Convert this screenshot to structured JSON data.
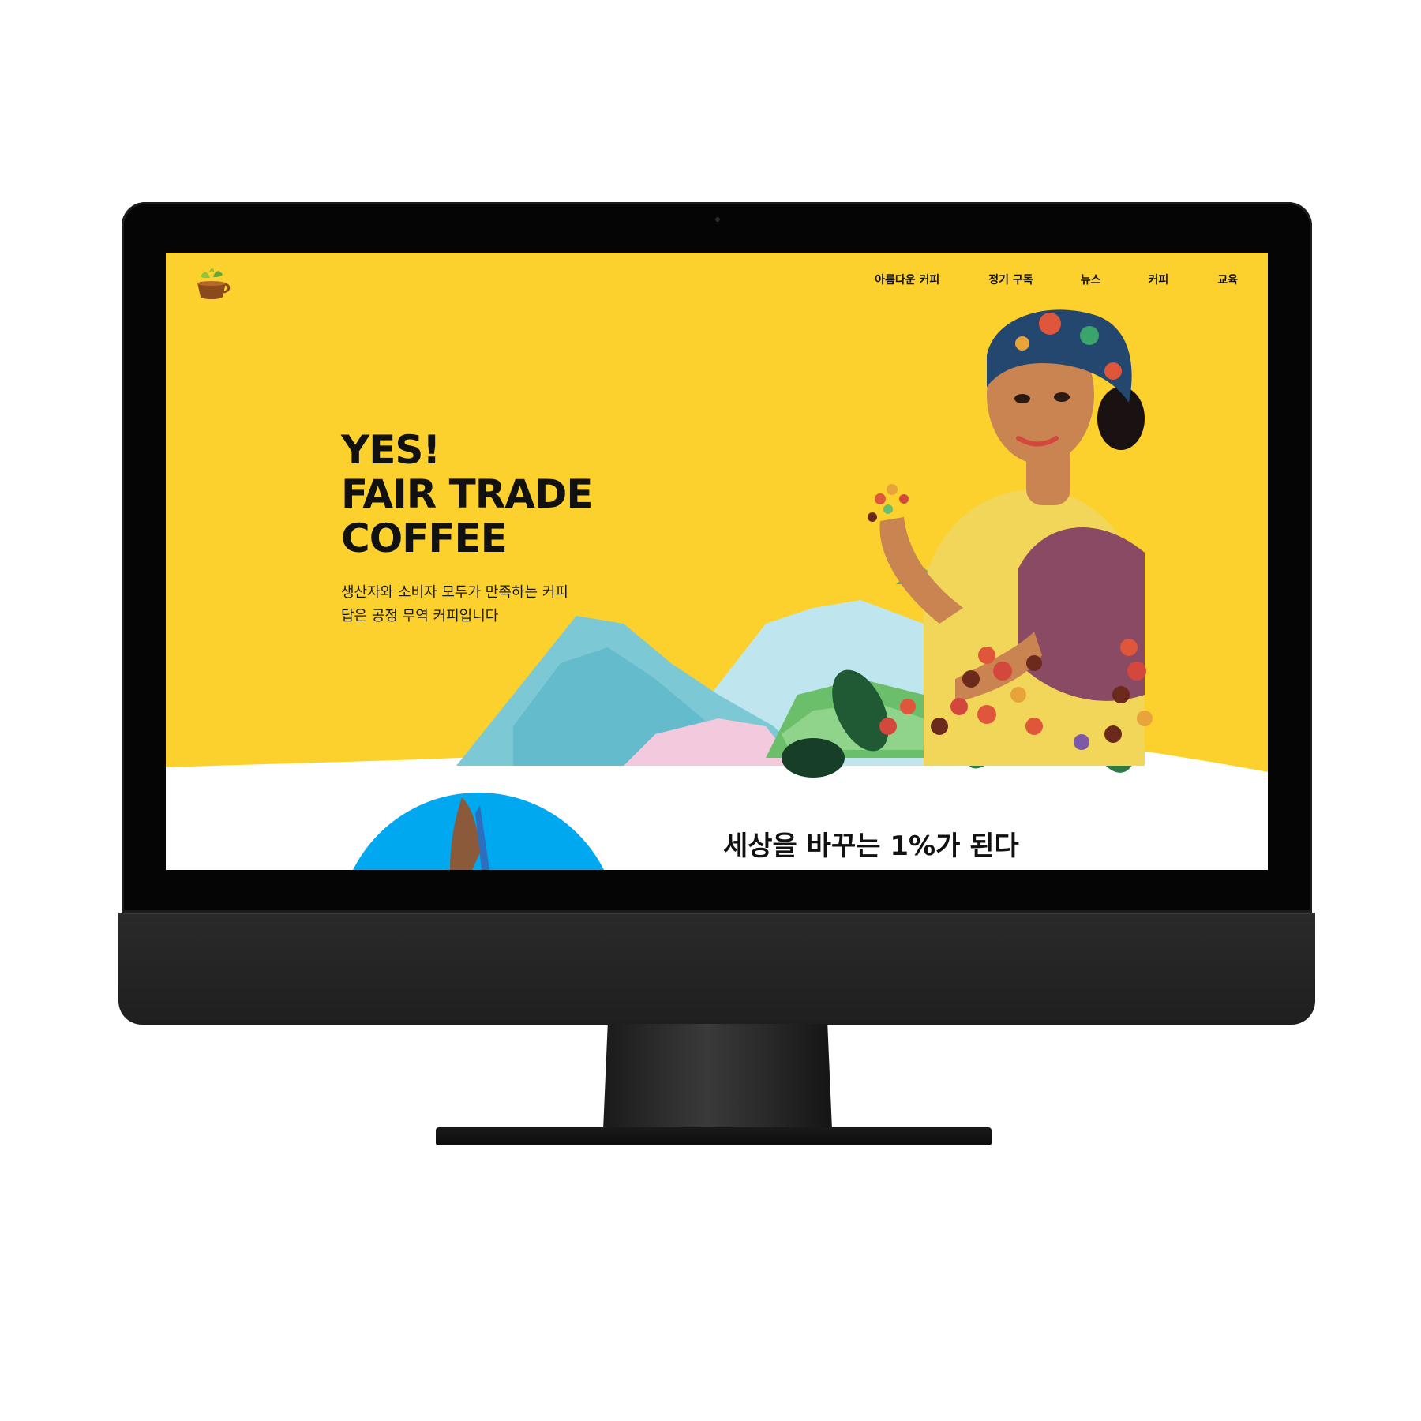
{
  "nav": {
    "items": [
      {
        "label": "아름다운 커피"
      },
      {
        "label": "정기 구독"
      },
      {
        "label": "뉴스"
      },
      {
        "label": "커피"
      },
      {
        "label": "교육"
      }
    ]
  },
  "hero": {
    "title_lines": [
      "YES!",
      "FAIR TRADE",
      "COFFEE"
    ],
    "subtitle_lines": [
      "생산자와 소비자 모두가 만족하는 커피",
      "답은 공정 무역 커피입니다"
    ]
  },
  "section": {
    "title": "세상을 바꾸는 1%가 된다"
  },
  "colors": {
    "hero_background": "#fdd12d",
    "accent_blue": "#00a8f0",
    "device_dark": "#2a2a2a"
  },
  "icons": {
    "logo": "coffee-cup-leaf-icon"
  }
}
